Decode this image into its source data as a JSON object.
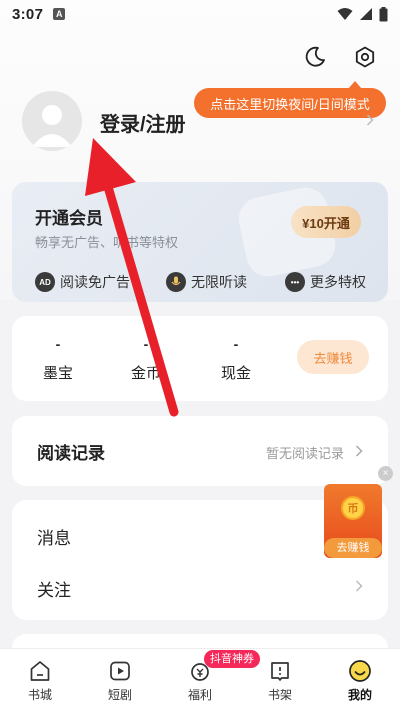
{
  "status_bar": {
    "time": "3:07",
    "notif_letter": "A"
  },
  "header": {
    "night_mode_icon": "moon-icon",
    "settings_icon": "hexagon-gear-icon"
  },
  "tooltip": {
    "text": "点击这里切换夜间/日间模式"
  },
  "profile": {
    "login_label": "登录/注册"
  },
  "vip": {
    "title": "开通会员",
    "subtitle": "畅享无广告、听书等特权",
    "button": "¥10开通",
    "features": [
      {
        "label": "阅读免广告",
        "icon": "ad-free-icon"
      },
      {
        "label": "无限听读",
        "icon": "microphone-icon"
      },
      {
        "label": "更多特权",
        "icon": "more-dots-icon"
      }
    ]
  },
  "wallet": {
    "stats": [
      {
        "value": "-",
        "label": "墨宝"
      },
      {
        "value": "-",
        "label": "金币"
      },
      {
        "value": "-",
        "label": "现金"
      }
    ],
    "earn_button": "去赚钱"
  },
  "reading_record": {
    "title": "阅读记录",
    "hint": "暂无阅读记录"
  },
  "messages": {
    "title": "消息"
  },
  "follow": {
    "title": "关注"
  },
  "floating_widget": {
    "coin_text": "币",
    "label": "去赚钱"
  },
  "bottom_nav": {
    "badge": "抖音神券",
    "items": [
      {
        "label": "书城",
        "icon": "home-icon"
      },
      {
        "label": "短剧",
        "icon": "play-icon"
      },
      {
        "label": "福利",
        "icon": "gift-icon"
      },
      {
        "label": "书架",
        "icon": "bookshelf-icon"
      },
      {
        "label": "我的",
        "icon": "smiley-icon"
      }
    ],
    "active_index": 4
  },
  "colors": {
    "accent": "#f3712c",
    "annotation_arrow": "#e8202a",
    "badge": "#f5285a"
  }
}
